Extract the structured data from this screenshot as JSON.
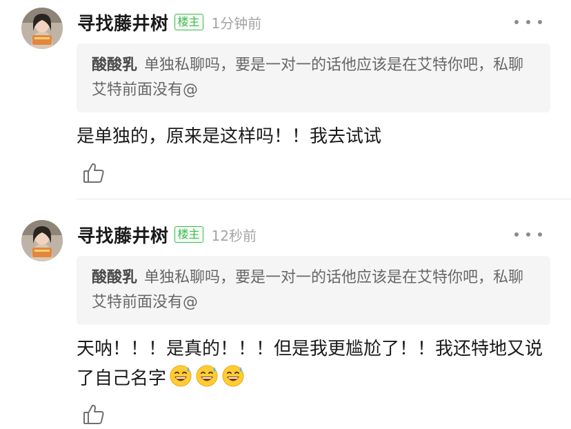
{
  "comments": [
    {
      "username": "寻找藤井树",
      "badge": "楼主",
      "timestamp": "1分钟前",
      "quote_author": "酸酸乳",
      "quote_text": "单独私聊吗，要是一对一的话他应该是在艾特你吧，私聊艾特前面没有@",
      "reply_text": "是单独的，原来是这样吗！！我去试试",
      "reply_emojis": []
    },
    {
      "username": "寻找藤井树",
      "badge": "楼主",
      "timestamp": "12秒前",
      "quote_author": "酸酸乳",
      "quote_text": "单独私聊吗，要是一对一的话他应该是在艾特你吧，私聊艾特前面没有@",
      "reply_text": "天呐！！！是真的！！！但是我更尴尬了！！我还特地又说了自己名字",
      "reply_emojis": [
        "sweat-smile-emoji",
        "sweat-smile-emoji",
        "sweat-smile-emoji"
      ]
    }
  ],
  "icons": {
    "more": "more-dots-icon",
    "like": "thumbs-up-icon"
  },
  "colors": {
    "badge_green": "#3fb84f",
    "quote_bg": "#f5f5f5",
    "timestamp_gray": "#a3a3a3"
  }
}
